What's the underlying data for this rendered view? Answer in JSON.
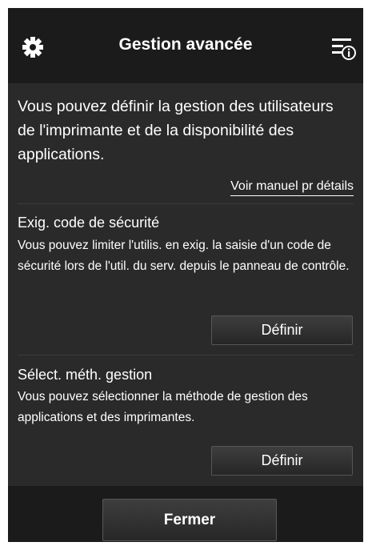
{
  "header": {
    "title": "Gestion avancée",
    "left_icon": "gear-icon",
    "right_icon": "info-menu-icon"
  },
  "intro": {
    "text": "Vous pouvez définir la gestion des utilisateurs de l'imprimante et de la disponibilité des applications.",
    "link": "Voir manuel pr détails"
  },
  "sections": [
    {
      "title": "Exig. code de sécurité",
      "description": "Vous pouvez limiter l'utilis. en exig. la saisie d'un code de sécurité lors de l'util. du serv. depuis le panneau de contrôle.",
      "button": "Définir"
    },
    {
      "title": "Sélect. méth. gestion",
      "description": "Vous pouvez sélectionner la méthode de gestion des applications et des imprimantes.",
      "button": "Définir"
    }
  ],
  "footer": {
    "close_button": "Fermer"
  },
  "colors": {
    "header_bg": "#1b1b1b",
    "content_bg": "#2a2a2a",
    "text": "#ffffff"
  }
}
